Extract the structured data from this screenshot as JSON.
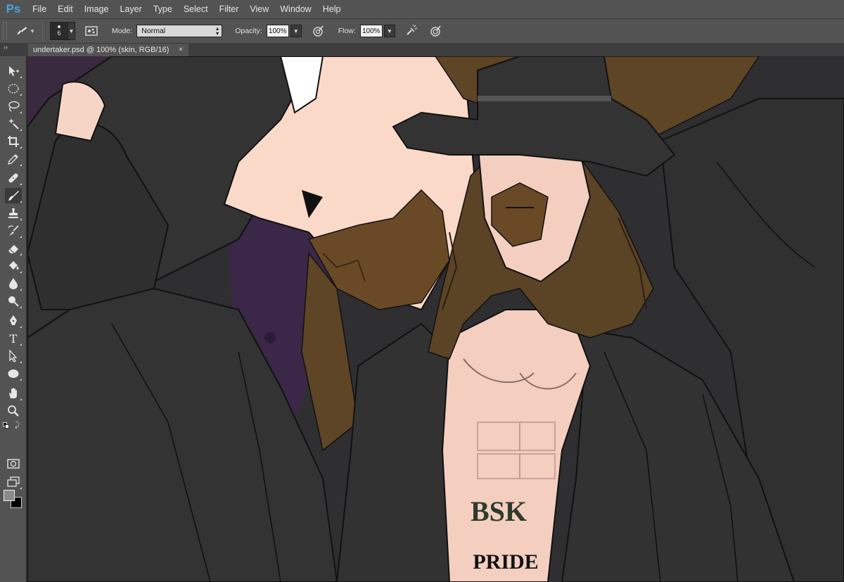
{
  "app": {
    "logo_text": "Ps",
    "menu": [
      "File",
      "Edit",
      "Image",
      "Layer",
      "Type",
      "Select",
      "Filter",
      "View",
      "Window",
      "Help"
    ]
  },
  "options": {
    "brush_size": "6",
    "mode_label": "Mode:",
    "mode_value": "Normal",
    "opacity_label": "Opacity:",
    "opacity_value": "100%",
    "flow_label": "Flow:",
    "flow_value": "100%"
  },
  "document": {
    "tab_title": "undertaker.psd @ 100% (skin, RGB/16)",
    "close_glyph": "×"
  },
  "tools": [
    {
      "name": "move-tool-icon"
    },
    {
      "name": "elliptical-marquee-tool-icon"
    },
    {
      "name": "lasso-tool-icon"
    },
    {
      "name": "magic-wand-tool-icon"
    },
    {
      "name": "crop-tool-icon"
    },
    {
      "name": "eyedropper-tool-icon"
    },
    {
      "name": "healing-brush-tool-icon"
    },
    {
      "name": "brush-tool-icon"
    },
    {
      "name": "clone-stamp-tool-icon"
    },
    {
      "name": "history-brush-tool-icon"
    },
    {
      "name": "eraser-tool-icon"
    },
    {
      "name": "paint-bucket-tool-icon"
    },
    {
      "name": "blur-tool-icon"
    },
    {
      "name": "dodge-tool-icon"
    },
    {
      "name": "pen-tool-icon"
    },
    {
      "name": "type-tool-icon"
    },
    {
      "name": "path-selection-tool-icon"
    },
    {
      "name": "ellipse-tool-icon"
    },
    {
      "name": "hand-tool-icon"
    },
    {
      "name": "zoom-tool-icon"
    }
  ],
  "type_tool_glyph": "T",
  "colors": {
    "foreground": "#8a8a8a",
    "background": "#000000",
    "accent": "#4aa3df"
  },
  "artwork": {
    "tattoo_text": "PRIDE",
    "tattoo_letters": "BSK"
  }
}
